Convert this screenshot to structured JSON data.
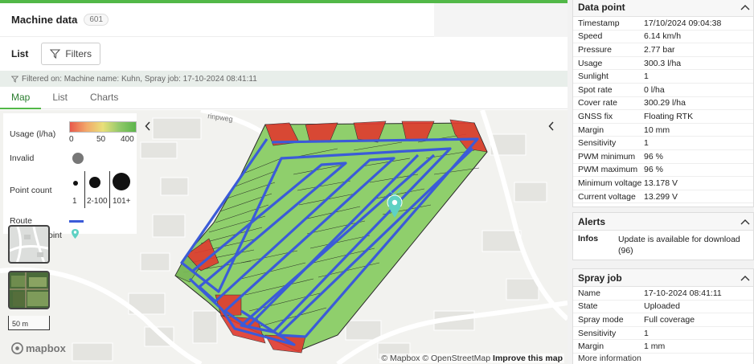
{
  "header": {
    "title": "Machine data",
    "count": "601"
  },
  "list_section": {
    "label": "List",
    "filters_label": "Filters"
  },
  "filter_note": "Filtered on: Machine name: Kuhn, Spray job: 17-10-2024 08:41:11",
  "tabs": [
    {
      "label": "Map",
      "active": true
    },
    {
      "label": "List",
      "active": false
    },
    {
      "label": "Charts",
      "active": false
    }
  ],
  "map": {
    "street_label": "rinpweg",
    "legend": {
      "usage_label": "Usage (l/ha)",
      "usage_ticks": [
        "0",
        "50",
        "400"
      ],
      "invalid_label": "Invalid",
      "point_count_label": "Point count",
      "point_count_ticks": [
        "1",
        "2-100",
        "101+"
      ],
      "route_label": "Route",
      "data_point_label": "oint"
    },
    "scale_label": "50 m",
    "logo": "mapbox",
    "attribution_prefix": "© Mapbox © OpenStreetMap",
    "improve_link": "Improve this map",
    "colors": {
      "route": "#3b5bd8",
      "marker": "#5ed1c3",
      "high_usage": "#e03a2f",
      "normal_usage": "#8fcf6c"
    }
  },
  "data_point": {
    "title": "Data point",
    "rows": [
      {
        "k": "Timestamp",
        "v": "17/10/2024 09:04:38"
      },
      {
        "k": "Speed",
        "v": "6.14 km/h"
      },
      {
        "k": "Pressure",
        "v": "2.77 bar"
      },
      {
        "k": "Usage",
        "v": "300.3 l/ha"
      },
      {
        "k": "Sunlight",
        "v": "1"
      },
      {
        "k": "Spot rate",
        "v": "0 l/ha"
      },
      {
        "k": "Cover rate",
        "v": "300.29 l/ha"
      },
      {
        "k": "GNSS fix",
        "v": "Floating RTK"
      },
      {
        "k": "Margin",
        "v": "10 mm"
      },
      {
        "k": "Sensitivity",
        "v": "1"
      },
      {
        "k": "PWM minimum",
        "v": "96 %"
      },
      {
        "k": "PWM maximum",
        "v": "96 %"
      },
      {
        "k": "Minimum voltage",
        "v": "13.178 V"
      },
      {
        "k": "Current voltage",
        "v": "13.299 V"
      }
    ]
  },
  "alerts": {
    "title": "Alerts",
    "k": "Infos",
    "v": "Update is available for download (96)"
  },
  "spray_job": {
    "title": "Spray job",
    "rows": [
      {
        "k": "Name",
        "v": "17-10-2024 08:41:11"
      },
      {
        "k": "State",
        "v": "Uploaded"
      },
      {
        "k": "Spray mode",
        "v": "Full coverage"
      },
      {
        "k": "Sensitivity",
        "v": "1"
      },
      {
        "k": "Margin",
        "v": "1 mm"
      }
    ],
    "more_label": "More information"
  }
}
